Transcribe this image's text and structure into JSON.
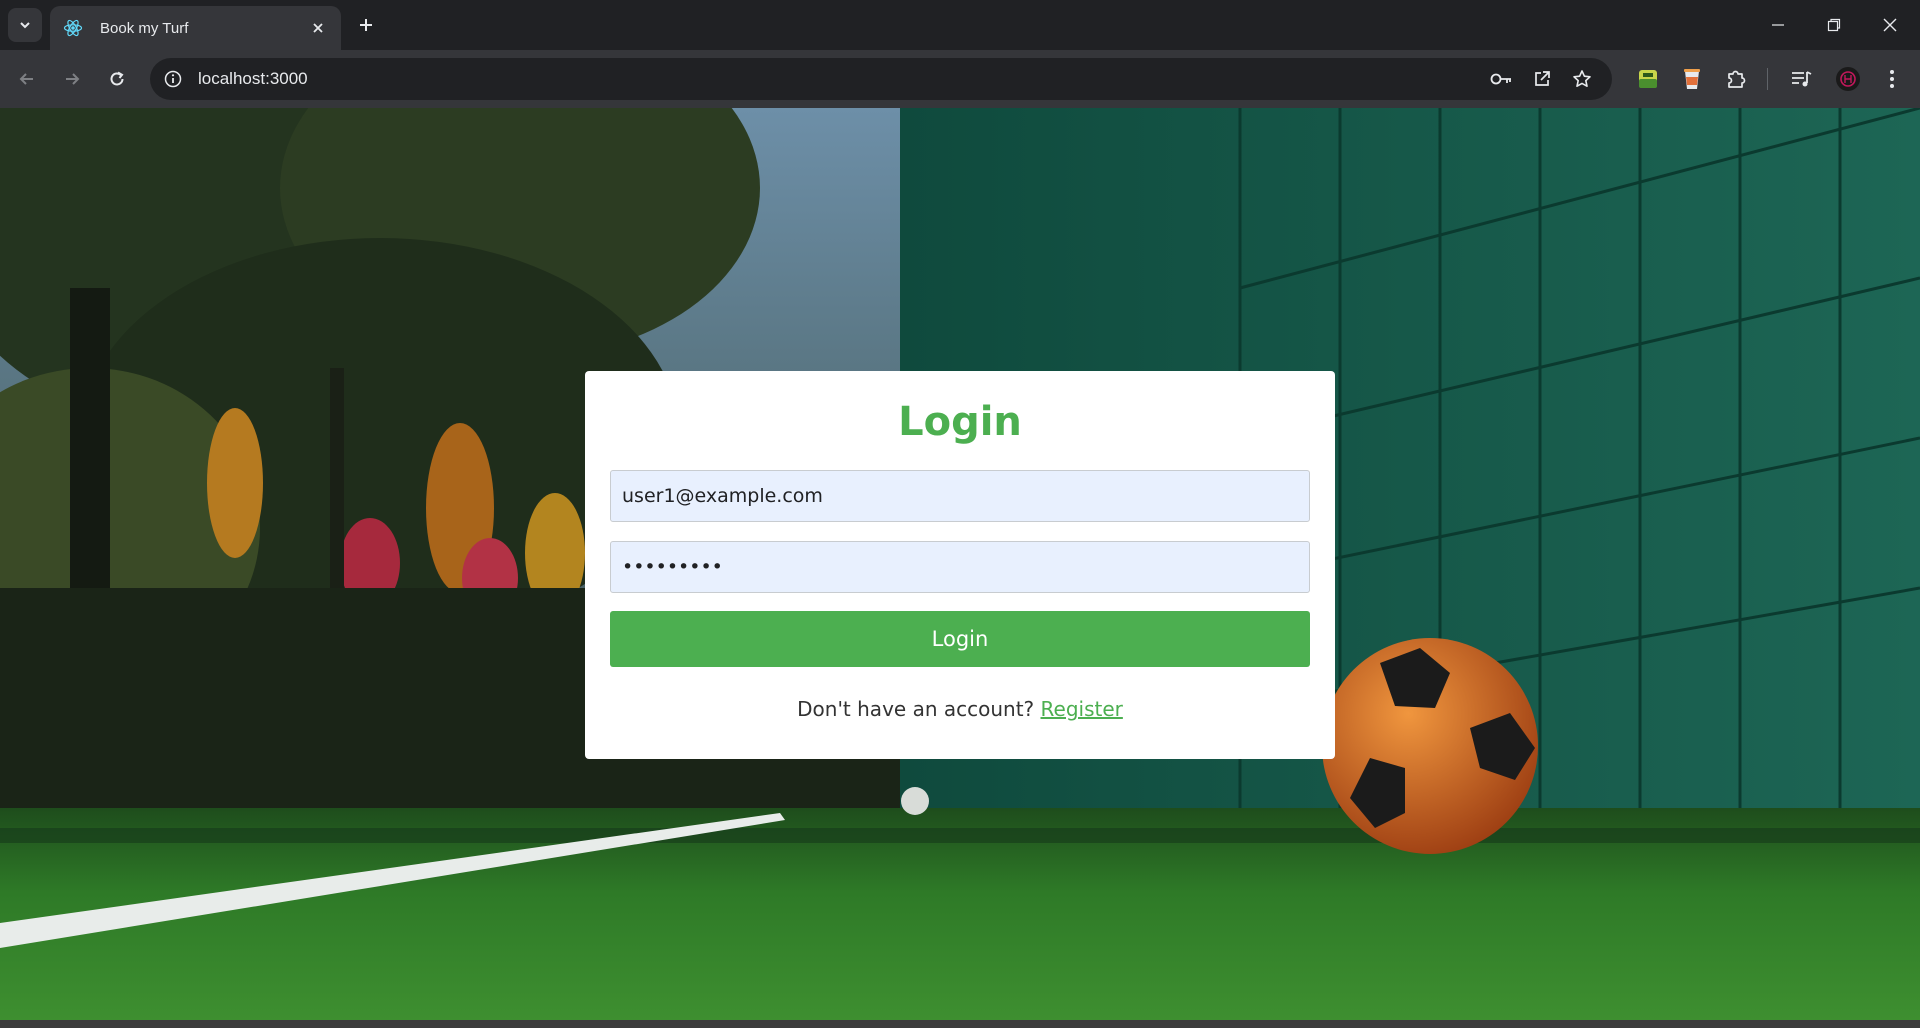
{
  "browser": {
    "tab": {
      "title": "Book my Turf"
    },
    "address": {
      "url": "localhost:3000"
    }
  },
  "login": {
    "title": "Login",
    "email": {
      "value": "user1@example.com"
    },
    "password": {
      "masked": "•••••••••"
    },
    "submit_label": "Login",
    "register_prompt": "Don't have an account?",
    "register_link": "Register"
  },
  "colors": {
    "accent": "#4caf50",
    "card_bg": "#ffffff",
    "input_bg": "#e8f0fe",
    "browser_chrome": "#35363a",
    "tabstrip": "#202124"
  }
}
